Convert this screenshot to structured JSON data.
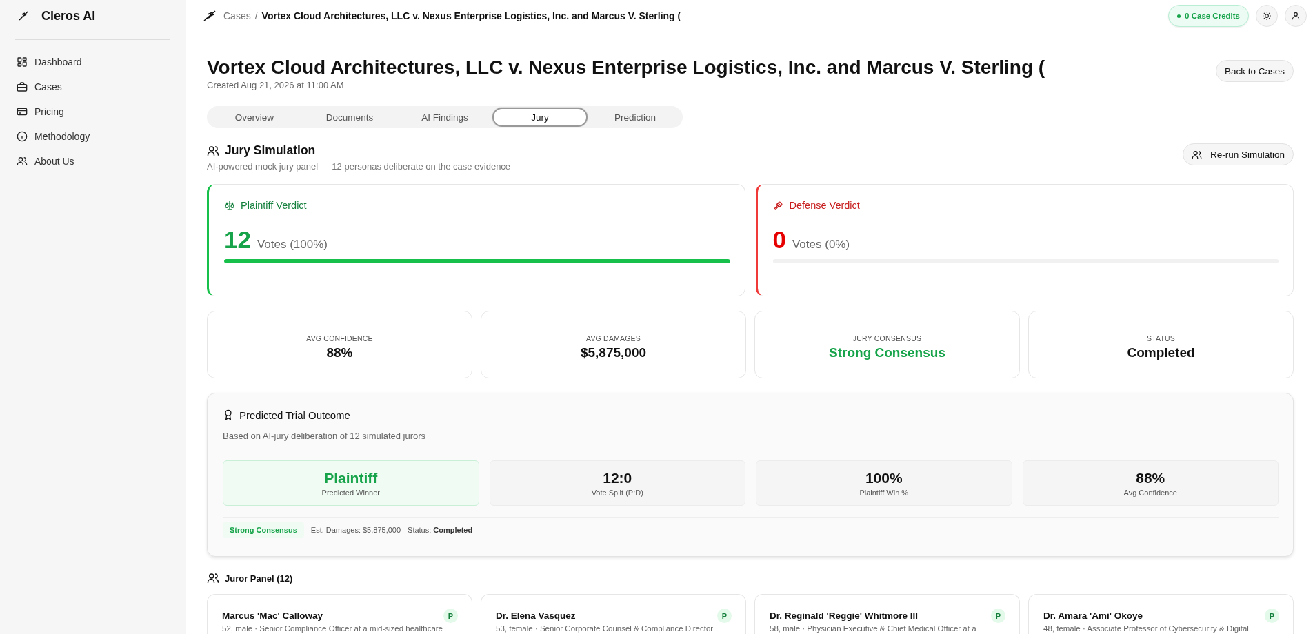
{
  "sidebar": {
    "brand": "Cleros AI",
    "items": [
      {
        "label": "Dashboard"
      },
      {
        "label": "Cases"
      },
      {
        "label": "Pricing"
      },
      {
        "label": "Methodology"
      },
      {
        "label": "About Us"
      }
    ]
  },
  "topbar": {
    "separator": "/",
    "breadcrumb": [
      "Cases",
      "Vortex Cloud Architectures, LLC v. Nexus Enterprise Logistics, Inc. and Marcus V. Sterling ("
    ],
    "credits": "0 Case Credits"
  },
  "header": {
    "title": "Vortex Cloud Architectures, LLC v. Nexus Enterprise Logistics, Inc. and Marcus V. Sterling (",
    "created": "Created Aug 21, 2026 at 11:00 AM",
    "back_button": "Back to Cases"
  },
  "tabs": [
    {
      "label": "Overview",
      "selected": false
    },
    {
      "label": "Documents",
      "selected": false
    },
    {
      "label": "AI Findings",
      "selected": false
    },
    {
      "label": "Jury",
      "selected": true
    },
    {
      "label": "Prediction",
      "selected": false
    }
  ],
  "jury": {
    "title": "Jury Simulation",
    "subtitle": "AI-powered mock jury panel — 12 personas deliberate on the case evidence",
    "rerun_button": "Re-run Simulation"
  },
  "verdicts": [
    {
      "kind": "plaintiff",
      "title": "Plaintiff Verdict",
      "count": "12",
      "votes": "Votes (100%)",
      "level": 1
    },
    {
      "kind": "defense",
      "title": "Defense Verdict",
      "count": "0",
      "votes": "Votes (0%)",
      "level": 0
    }
  ],
  "stats": [
    {
      "label": "AVG CONFIDENCE",
      "value": "88%",
      "highlighted": false
    },
    {
      "label": "AVG DAMAGES",
      "value": "$5,875,000",
      "highlighted": false
    },
    {
      "label": "JURY CONSENSUS",
      "value": "Strong Consensus",
      "highlighted": true
    },
    {
      "label": "STATUS",
      "value": "Completed",
      "highlighted": false
    }
  ],
  "outcome": {
    "title": "Predicted Trial Outcome",
    "subtitle": "Based on AI-jury deliberation of 12 simulated jurors",
    "tiles": [
      {
        "value": "Plaintiff",
        "label": "Predicted Winner",
        "highlighted": true
      },
      {
        "value": "12:0",
        "label": "Vote Split (P:D)",
        "highlighted": false
      },
      {
        "value": "100%",
        "label": "Plaintiff Win %",
        "highlighted": false
      },
      {
        "value": "88%",
        "label": "Avg Confidence",
        "highlighted": false
      }
    ],
    "badge": "Strong Consensus",
    "damages": "Est. Damages: $5,875,000",
    "status": "Status: **Completed**"
  },
  "jurors": {
    "title": "Juror Panel (12)",
    "items": [
      {
        "name": "Marcus 'Mac' Calloway",
        "vote": "P",
        "description": "52, male · Senior Compliance Officer at a mid-sized healthcare"
      },
      {
        "name": "Dr. Elena Vasquez",
        "vote": "P",
        "description": "53, female · Senior Corporate Counsel & Compliance Director"
      },
      {
        "name": "Dr. Reginald 'Reggie' Whitmore III",
        "vote": "P",
        "description": "58, male · Physician Executive & Chief Medical Officer at a"
      },
      {
        "name": "Dr. Amara 'Ami' Okoye",
        "vote": "P",
        "description": "48, female · Associate Professor of Cybersecurity & Digital"
      }
    ]
  }
}
